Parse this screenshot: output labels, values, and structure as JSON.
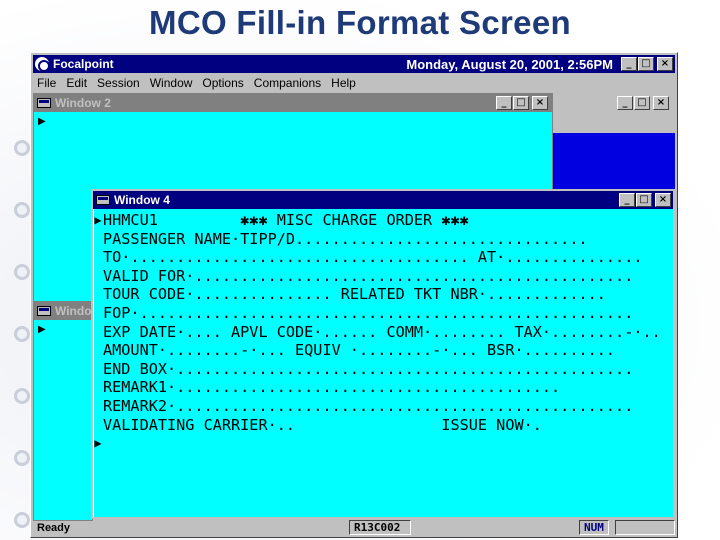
{
  "slide": {
    "title": "MCO Fill-in Format Screen"
  },
  "app": {
    "name": "Focalpoint",
    "datetime": "Monday, August 20, 2001, 2:56PM",
    "window_buttons": [
      "_",
      "□",
      "×"
    ]
  },
  "menu": [
    {
      "label": "File"
    },
    {
      "label": "Edit"
    },
    {
      "label": "Session"
    },
    {
      "label": "Window"
    },
    {
      "label": "Options"
    },
    {
      "label": "Companions"
    },
    {
      "label": "Help"
    }
  ],
  "windows": {
    "window2": {
      "title": "Window 2"
    },
    "window3": {
      "title": "Windo"
    },
    "window4": {
      "title": "Window 4"
    }
  },
  "terminal_lines": [
    {
      "marker": "▶",
      "text": "HHMCU1         ✱✱✱ MISC CHARGE ORDER ✱✱✱"
    },
    {
      "marker": "",
      "text": "PASSENGER NAME·TIPP/D................................"
    },
    {
      "marker": "",
      "text": "TO·..................................... AT·..............."
    },
    {
      "marker": "",
      "text": "VALID FOR·................................................"
    },
    {
      "marker": "",
      "text": "TOUR CODE·............... RELATED TKT NBR·............."
    },
    {
      "marker": "",
      "text": "FOP·......................................................"
    },
    {
      "marker": "",
      "text": "EXP DATE·.... APVL CODE·...... COMM·........ TAX·........-·.."
    },
    {
      "marker": "",
      "text": "AMOUNT·........-·... EQUIV ·........-·... BSR·.........."
    },
    {
      "marker": "",
      "text": "END BOX·.................................................."
    },
    {
      "marker": "",
      "text": "REMARK1·.........................................."
    },
    {
      "marker": "",
      "text": "REMARK2·.................................................."
    },
    {
      "marker": "",
      "text": "VALIDATING CARRIER·..                ISSUE NOW·."
    },
    {
      "marker": "▶",
      "text": ""
    }
  ],
  "status": {
    "ready": "Ready",
    "code": "R13C002",
    "num": "NUM"
  }
}
